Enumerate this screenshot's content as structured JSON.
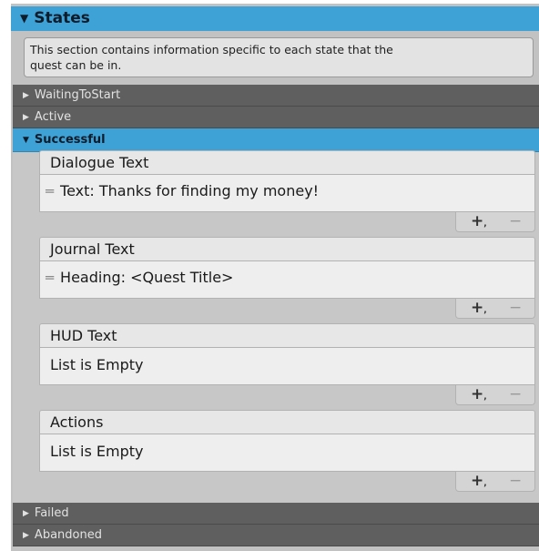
{
  "states": {
    "title": "States",
    "help_text_line1": "This section contains information specific to each state that the",
    "help_text_line2": "quest can be in."
  },
  "folds": {
    "waiting": "WaitingToStart",
    "active": "Active",
    "successful": "Successful",
    "failed": "Failed",
    "abandoned": "Abandoned"
  },
  "lists": [
    {
      "title": "Dialogue Text",
      "item": "Text: Thanks for finding my money!"
    },
    {
      "title": "Journal Text",
      "item": "Heading: <Quest Title>"
    },
    {
      "title": "HUD Text",
      "empty": "List is Empty"
    },
    {
      "title": "Actions",
      "empty": "List is Empty"
    }
  ],
  "controls": {
    "add": "+",
    "remove": "−"
  },
  "colors": {
    "accent": "#3ea2d6",
    "collapsed": "#5f5f5f"
  }
}
